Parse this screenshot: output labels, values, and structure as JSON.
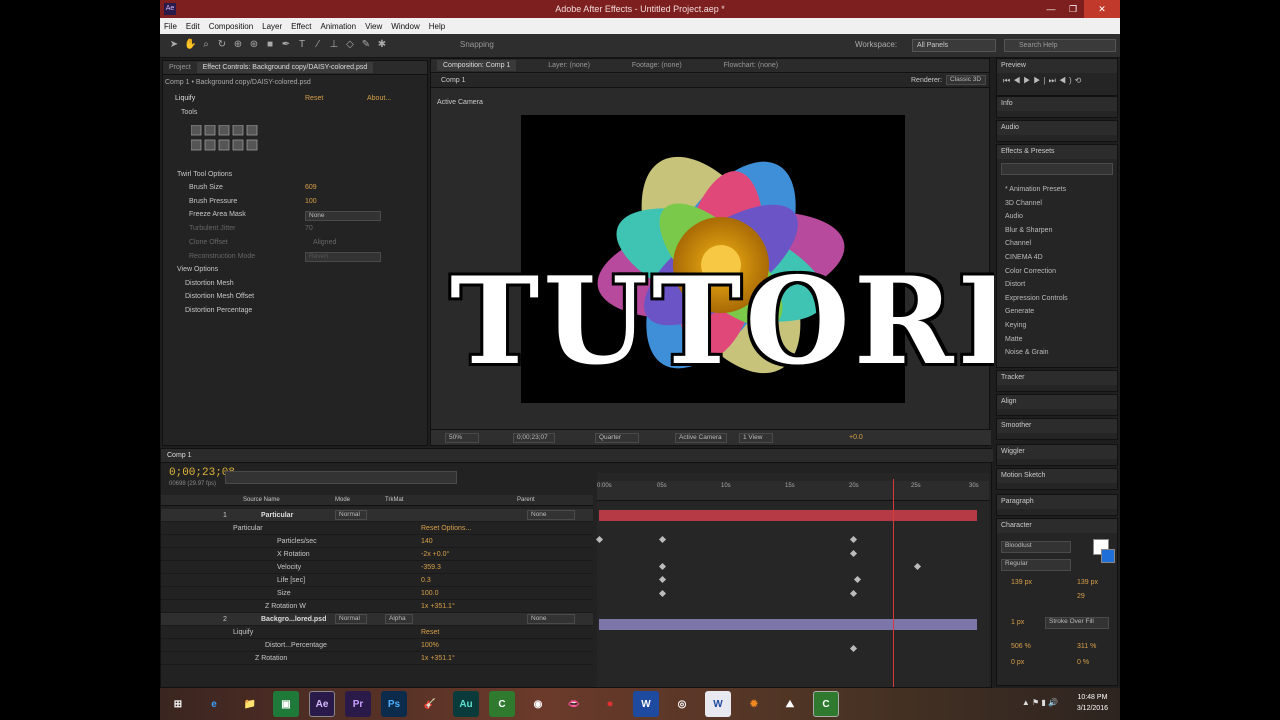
{
  "app": {
    "title": "Adobe After Effects - Untitled Project.aep *",
    "logo": "Ae",
    "win_min": "—",
    "win_max": "❐",
    "win_close": "✕"
  },
  "menu": [
    "File",
    "Edit",
    "Composition",
    "Layer",
    "Effect",
    "Animation",
    "View",
    "Window",
    "Help"
  ],
  "toolbar": {
    "snapping": "Snapping",
    "workspace_label": "Workspace:",
    "workspace_value": "All Panels",
    "search_placeholder": "Search Help"
  },
  "left_panel": {
    "tab_project": "Project",
    "tab_effect_controls": "Effect Controls: Background copy/DAISY-colored.psd",
    "breadcrumb": "Comp 1 • Background copy/DAISY-colored.psd",
    "effect_name": "Liquify",
    "reset": "Reset",
    "about": "About...",
    "tools_label": "Tools",
    "twirl_options": "Twirl Tool Options",
    "brush_size_label": "Brush Size",
    "brush_size_value": "609",
    "brush_pressure_label": "Brush Pressure",
    "brush_pressure_value": "100",
    "freeze_label": "Freeze Area Mask",
    "freeze_value": "None",
    "turbulent_label": "Turbulent Jitter",
    "turbulent_value": "70",
    "clone_label": "Clone Offset",
    "clone_value": "Aligned",
    "recon_label": "Reconstruction Mode",
    "recon_value": "Revert",
    "view_options": "View Options",
    "dist_mesh": "Distortion Mesh",
    "dist_mesh_offset": "Distortion Mesh Offset",
    "dist_percentage": "Distortion Percentage"
  },
  "viewer": {
    "tab_comp": "Composition: Comp 1",
    "tab_layer": "Layer: (none)",
    "tab_footage": "Footage: (none)",
    "tab_flowchart": "Flowchart: (none)",
    "comp_tab": "Comp 1",
    "renderer_label": "Renderer:",
    "renderer_value": "Classic 3D",
    "active_camera": "Active Camera",
    "zoom": "50%",
    "time": "0;00;23;07",
    "quality": "Quarter",
    "camera": "Active Camera",
    "views": "1 View",
    "exposure": "+0.0"
  },
  "overlay_title": "TUTORIAL",
  "timeline": {
    "tab": "Comp 1",
    "timecode": "0;00;23;08",
    "fps": "00698 (29.97 fps)",
    "col_source": "Source Name",
    "col_mode": "Mode",
    "col_trkmat": "TrkMat",
    "col_parent": "Parent",
    "rows": [
      {
        "num": "1",
        "name": "Particular",
        "mode": "Normal",
        "parent": "None",
        "value": ""
      },
      {
        "num": "",
        "name": "Particular",
        "mode": "",
        "parent": "",
        "value": "Reset   Options..."
      },
      {
        "num": "",
        "name": "Particles/sec",
        "mode": "",
        "parent": "",
        "value": "140"
      },
      {
        "num": "",
        "name": "X Rotation",
        "mode": "",
        "parent": "",
        "value": "-2x +0.0°"
      },
      {
        "num": "",
        "name": "Velocity",
        "mode": "",
        "parent": "",
        "value": "-359.3"
      },
      {
        "num": "",
        "name": "Life [sec]",
        "mode": "",
        "parent": "",
        "value": "0.3"
      },
      {
        "num": "",
        "name": "Size",
        "mode": "",
        "parent": "",
        "value": "100.0"
      },
      {
        "num": "",
        "name": "Z Rotation W",
        "mode": "",
        "parent": "",
        "value": "1x +351.1°"
      },
      {
        "num": "2",
        "name": "Backgro...lored.psd",
        "mode": "Normal",
        "parent": "None",
        "value": "Alpha"
      },
      {
        "num": "",
        "name": "Liquify",
        "mode": "",
        "parent": "",
        "value": "Reset"
      },
      {
        "num": "",
        "name": "Distort...Percentage",
        "mode": "",
        "parent": "",
        "value": "100%"
      },
      {
        "num": "",
        "name": "Z Rotation",
        "mode": "",
        "parent": "",
        "value": "1x +351.1°"
      }
    ],
    "ruler": [
      "0:00s",
      "05s",
      "10s",
      "15s",
      "20s",
      "25s",
      "30s"
    ],
    "current_time_fraction": 0.78
  },
  "right_panels": {
    "preview": "Preview",
    "info": "Info",
    "audio": "Audio",
    "effects_presets": "Effects & Presets",
    "effects_list": [
      "* Animation Presets",
      "3D Channel",
      "Audio",
      "Blur & Sharpen",
      "Channel",
      "CINEMA 4D",
      "Color Correction",
      "Distort",
      "Expression Controls",
      "Generate",
      "Keying",
      "Matte",
      "Noise & Grain"
    ],
    "tracker": "Tracker",
    "align": "Align",
    "smoother": "Smoother",
    "wiggler": "Wiggler",
    "motion_sketch": "Motion Sketch",
    "paragraph": "Paragraph",
    "character": "Character",
    "font": "Bloodlust",
    "style": "Regular",
    "font_size": "139 px",
    "leading": "139 px",
    "tracking": "29",
    "stroke_width": "1 px",
    "stroke_mode": "Stroke Over Fill",
    "vscale": "506 %",
    "hscale": "311 %",
    "baseline": "0 px",
    "tsume": "0 %"
  },
  "taskbar": {
    "apps": [
      "⊞",
      "e",
      "📁",
      "▣",
      "Ae",
      "Pr",
      "Ps",
      "🎸",
      "Au",
      "C",
      "◉",
      "👄",
      "⏺",
      "W",
      "◎",
      "W",
      "✹",
      "⛰",
      "C"
    ],
    "time": "10:48 PM",
    "date": "3/12/2016"
  }
}
